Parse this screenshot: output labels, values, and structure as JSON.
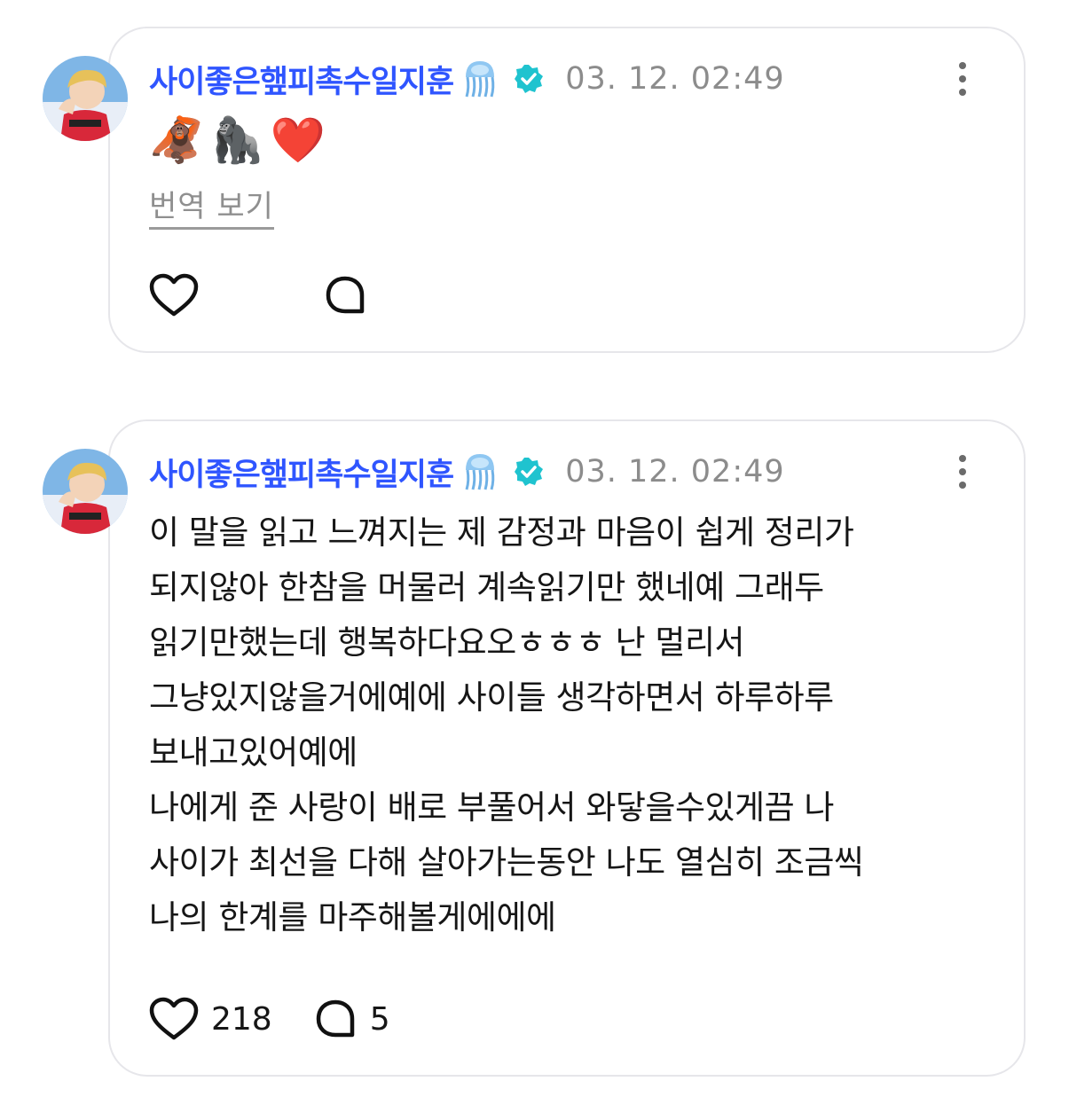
{
  "posts": [
    {
      "author": "사이좋은햎피촉수일지훈",
      "timestamp": "03. 12. 02:49",
      "content_emojis": [
        "🦧",
        "🦍",
        "❤️"
      ],
      "translate_label": "번역 보기",
      "likes": "",
      "comments": ""
    },
    {
      "author": "사이좋은햎피촉수일지훈",
      "timestamp": "03. 12. 02:49",
      "lines": [
        "이 말을 읽고 느껴지는 제 감정과 마음이 쉽게 정리가",
        "되지않아 한참을 머물러 계속읽기만 했네예 그래두",
        "읽기만했는데 행복하다요오ㅎㅎㅎ 난 멀리서",
        "그냥있지않을거에예에 사이들 생각하면서 하루하루",
        "보내고있어예에",
        "나에게 준 사랑이 배로 부풀어서 와닿을수있게끔 나",
        "사이가 최선을 다해 살아가는동안 나도 열심히 조금씩",
        "나의 한계를 마주해볼게에에에"
      ],
      "likes": "218",
      "comments": "5"
    }
  ],
  "icons": {
    "author_emoji": "jellyfish-icon",
    "verified": "verified-badge-icon",
    "more": "more-vertical-icon",
    "like": "heart-icon",
    "comment": "comment-bubble-icon"
  },
  "colors": {
    "author": "#2f55ff",
    "verified": "#1fc3cf",
    "timestamp": "#8c8c8c",
    "border": "#e6e6ea"
  }
}
